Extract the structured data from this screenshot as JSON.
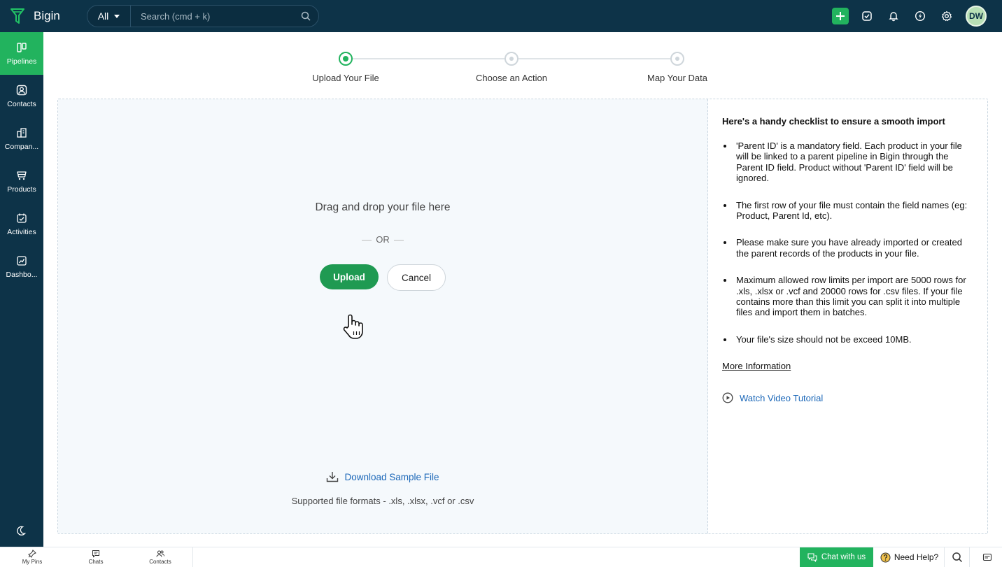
{
  "app": {
    "name": "Bigin"
  },
  "search": {
    "scope": "All",
    "placeholder": "Search (cmd + k)"
  },
  "user": {
    "initials": "DW"
  },
  "sidebar": {
    "items": [
      {
        "label": "Pipelines",
        "icon": "pipelines-icon",
        "active": true
      },
      {
        "label": "Contacts",
        "icon": "contacts-icon"
      },
      {
        "label": "Compan...",
        "icon": "companies-icon"
      },
      {
        "label": "Products",
        "icon": "products-icon"
      },
      {
        "label": "Activities",
        "icon": "activities-icon"
      },
      {
        "label": "Dashbo...",
        "icon": "dashboards-icon"
      }
    ]
  },
  "steps": [
    {
      "label": "Upload Your File",
      "active": true
    },
    {
      "label": "Choose an Action",
      "active": false
    },
    {
      "label": "Map Your Data",
      "active": false
    }
  ],
  "dropzone": {
    "title": "Drag and drop your file here",
    "or": "OR",
    "upload_label": "Upload",
    "cancel_label": "Cancel",
    "download_label": "Download Sample File",
    "formats": "Supported file formats - .xls, .xlsx, .vcf or .csv"
  },
  "checklist": {
    "title": "Here's a handy checklist to ensure a smooth import",
    "items": [
      "'Parent ID' is a mandatory field. Each product in your file will be linked to a parent pipeline in Bigin through the Parent ID field. Product without 'Parent ID' field will be ignored.",
      "The first row of your file must contain the field names (eg: Product, Parent Id, etc).",
      "Please make sure you have already imported or created the parent records of the products in your file.",
      "Maximum allowed row limits per import are 5000 rows for .xls, .xlsx or .vcf and 20000 rows for .csv files. If your file contains more than this limit you can split it into multiple files and import them in batches.",
      "Your file's size should not be exceed 10MB."
    ],
    "more_label": "More Information",
    "video_label": "Watch Video Tutorial"
  },
  "bottombar": {
    "pins_label": "My Pins",
    "chats_label": "Chats",
    "contacts_label": "Contacts",
    "chat_label": "Chat with us",
    "help_label": "Need Help?"
  },
  "colors": {
    "brand": "#0d3348",
    "accent": "#22b35e",
    "link": "#1b67b8"
  }
}
